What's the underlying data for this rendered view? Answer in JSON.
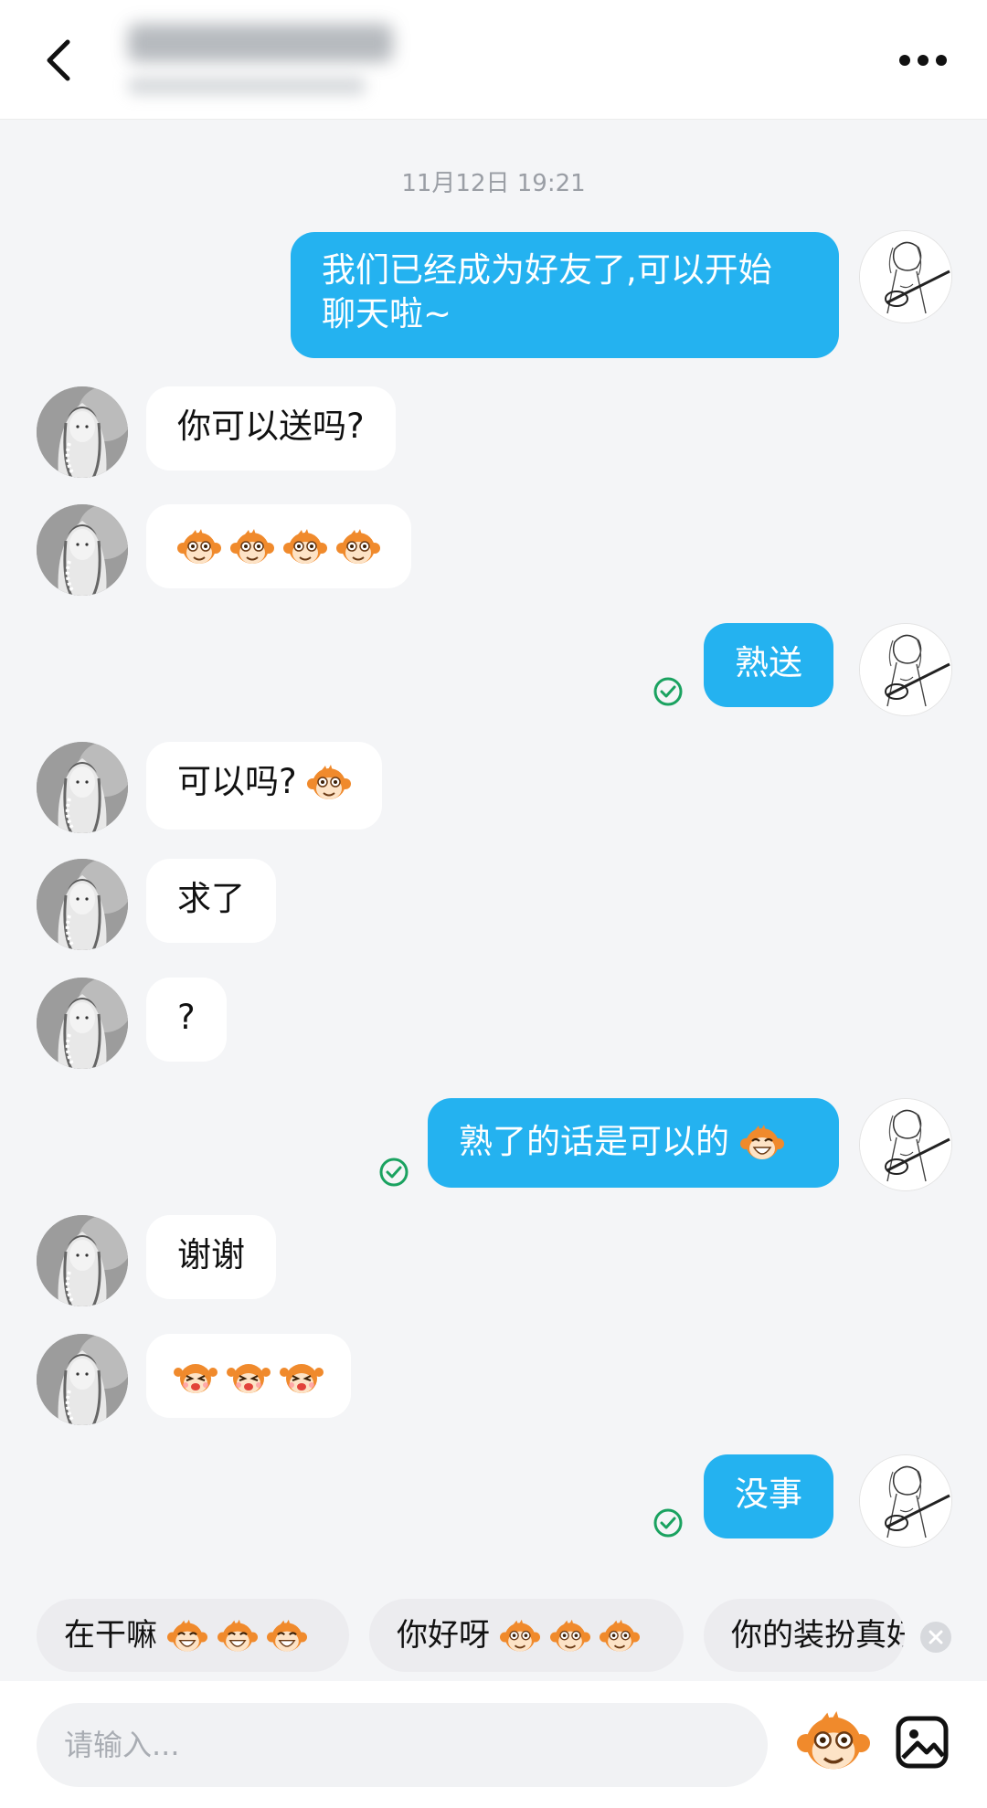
{
  "header": {
    "back_icon": "chevron-left-icon",
    "more_icon": "more-dots-icon",
    "title_blurred": true
  },
  "timestamp": "11月12日 19:21",
  "messages": [
    {
      "side": "right",
      "text": "我们已经成为好友了,可以开始",
      "text2": "聊天啦~"
    },
    {
      "side": "left",
      "text": "你可以送吗?"
    },
    {
      "side": "left",
      "text": "",
      "emojis": 4,
      "emoji_icon": "monkey-face-emoji"
    },
    {
      "side": "right",
      "text": "熟送",
      "status": "sent-check-icon"
    },
    {
      "side": "left",
      "text": "可以吗?",
      "emojis": 1,
      "emoji_icon": "monkey-face-emoji"
    },
    {
      "side": "left",
      "text": "求了"
    },
    {
      "side": "left",
      "text": "?"
    },
    {
      "side": "right",
      "text": "熟了的话是可以的",
      "emojis": 1,
      "emoji_icon": "monkey-laugh-emoji",
      "status": "sent-check-icon"
    },
    {
      "side": "left",
      "text": "谢谢"
    },
    {
      "side": "left",
      "text": "",
      "emojis": 3,
      "emoji_icon": "monkey-cheer-emoji"
    },
    {
      "side": "right",
      "text": "没事",
      "status": "sent-check-icon"
    }
  ],
  "quick_replies": [
    {
      "text": "在干嘛",
      "emojis": 3
    },
    {
      "text": "你好呀",
      "emojis": 3
    },
    {
      "text": "你的装扮真好"
    }
  ],
  "input": {
    "placeholder": "请输入...",
    "emoji_button_icon": "monkey-emoji-icon",
    "image_button_icon": "image-icon"
  },
  "colors": {
    "accent": "#24b2f0",
    "bubble_left": "#ffffff",
    "background": "#f4f5f7",
    "check": "#1aa260"
  }
}
